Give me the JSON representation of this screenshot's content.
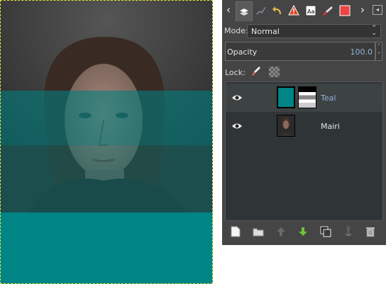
{
  "canvas": {
    "layer_color": "#008484"
  },
  "dock": {
    "tabs": [
      "layers-icon",
      "channels-icon",
      "undo-history-icon",
      "warning-icon",
      "fonts-icon",
      "brush-icon",
      "pattern-icon"
    ],
    "mode": {
      "label": "Mode:",
      "value": "Normal"
    },
    "opacity": {
      "label": "Opacity",
      "value": "100.0"
    },
    "lock": {
      "label": "Lock:"
    },
    "layers": [
      {
        "name": "Teal",
        "visible": true,
        "selected": true,
        "has_mask": true,
        "name_color": "#8fb3d9"
      },
      {
        "name": "Mairi",
        "visible": true,
        "selected": false,
        "has_mask": false,
        "name_color": "#e6e6e6"
      }
    ],
    "bottom_buttons": [
      "new-layer-icon",
      "open-folder-icon",
      "raise-layer-icon",
      "lower-layer-icon",
      "duplicate-layer-icon",
      "anchor-icon",
      "delete-layer-icon"
    ]
  }
}
